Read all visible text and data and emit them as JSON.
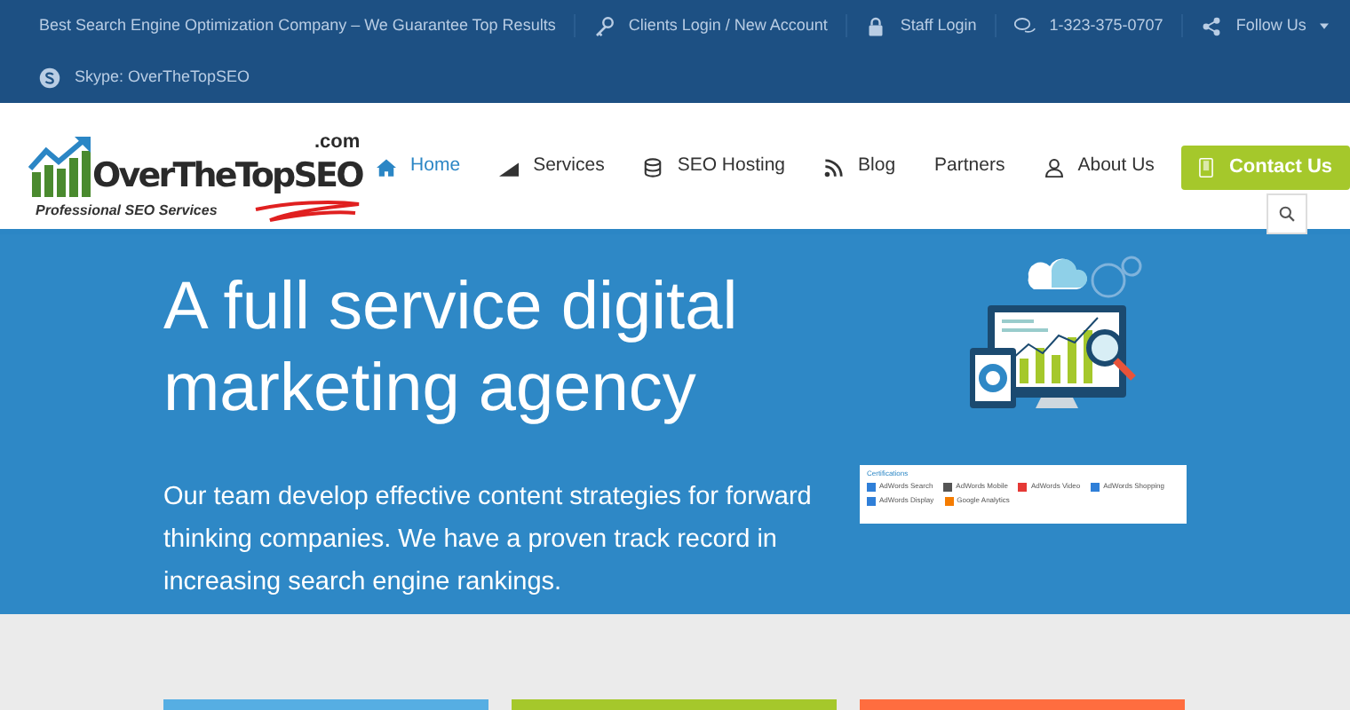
{
  "top_bar": {
    "items": [
      {
        "kind": "plain",
        "label": "Best Search Engine Optimization Company – We Guarantee Top Results",
        "dropdown": false
      },
      {
        "kind": "key",
        "label": "Clients Login / New Account",
        "dropdown": false
      },
      {
        "kind": "lock",
        "label": "Staff Login",
        "dropdown": false
      },
      {
        "kind": "chat",
        "label": "1-323-375-0707",
        "dropdown": false
      },
      {
        "kind": "share",
        "label": "Follow Us",
        "dropdown": true
      },
      {
        "kind": "skype",
        "label": "Skype: OverTheTopSEO",
        "dropdown": false
      }
    ]
  },
  "logo": {
    "name": "OverTheTopSEO",
    "domain": ".com",
    "tagline": "Professional SEO Services"
  },
  "nav": {
    "items": [
      {
        "kind": "home",
        "label": "Home",
        "selected": true
      },
      {
        "kind": "chart",
        "label": "Services",
        "selected": false
      },
      {
        "kind": "database",
        "label": "SEO Hosting",
        "selected": false
      },
      {
        "kind": "rss",
        "label": "Blog",
        "selected": false
      },
      {
        "kind": "plain",
        "label": "Partners",
        "selected": false
      },
      {
        "kind": "user",
        "label": "About Us",
        "selected": false
      }
    ],
    "contact_button": "Contact Us"
  },
  "hero": {
    "title": "A full service digital marketing agency",
    "text": "Our team develop effective content strategies for forward thinking companies. We have a proven track record in increasing search engine rankings.",
    "certifications": {
      "title": "Certifications",
      "items": [
        {
          "label": "AdWords Search",
          "color": "#2f7fd8"
        },
        {
          "label": "AdWords Mobile",
          "color": "#555555"
        },
        {
          "label": "AdWords Video",
          "color": "#e53935"
        },
        {
          "label": "AdWords Shopping",
          "color": "#2f7fd8"
        },
        {
          "label": "AdWords Display",
          "color": "#2f7fd8"
        },
        {
          "label": "Google Analytics",
          "color": "#f57c00"
        }
      ]
    }
  },
  "cards": [
    {
      "color": "#56aee3"
    },
    {
      "color": "#a5c82b"
    },
    {
      "color": "#ff6d3f"
    }
  ]
}
